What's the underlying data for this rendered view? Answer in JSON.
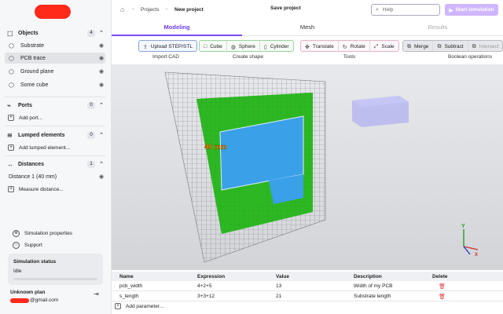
{
  "sidebar": {
    "objects": {
      "title": "Objects",
      "count": "4",
      "items": [
        {
          "label": "Substrate",
          "icon": "cube-icon"
        },
        {
          "label": "PCB trace",
          "icon": "cube-icon"
        },
        {
          "label": "Ground plane",
          "icon": "cube-icon"
        },
        {
          "label": "Some cube",
          "icon": "cube-icon"
        }
      ]
    },
    "ports": {
      "title": "Ports",
      "count": "0",
      "add": "Add port..."
    },
    "lumped": {
      "title": "Lumped elements",
      "count": "0",
      "add": "Add lumped element..."
    },
    "distances": {
      "title": "Distances",
      "count": "1",
      "items": [
        {
          "label": "Distance 1 (40 mm)"
        }
      ],
      "add": "Measure distance..."
    },
    "sim_props": "Simulation properties",
    "support": "Support",
    "status": {
      "title": "Simulation status",
      "value": "Idle"
    },
    "user": {
      "plan": "Unknown plan",
      "email_suffix": "@gmail.com"
    }
  },
  "topbar": {
    "breadcrumb": [
      "Projects",
      "New project"
    ],
    "save_label": "Save project",
    "help_placeholder": "Help",
    "start_label": "Start simulation"
  },
  "tabs": [
    {
      "label": "Modeling",
      "state": "active"
    },
    {
      "label": "Mesh",
      "state": "normal"
    },
    {
      "label": "Results",
      "state": "disabled"
    }
  ],
  "toolbar": {
    "import": {
      "label": "Import CAD",
      "buttons": [
        "Upload STEP/STL"
      ]
    },
    "shape": {
      "label": "Create shape",
      "buttons": [
        "Cube",
        "Sphere",
        "Cylinder"
      ]
    },
    "tools": {
      "label": "Tools",
      "buttons": [
        "Translate",
        "Rotate",
        "Scale"
      ]
    },
    "boolean": {
      "label": "Boolean operations",
      "buttons": [
        "Merge",
        "Subtract",
        "Intersect"
      ]
    }
  },
  "viewport": {
    "measure_label": "40 mm",
    "axis_y": "Y",
    "axis_x": "X",
    "colors": {
      "substrate": "#2db823",
      "trace": "#3aa0e8",
      "cube": "#b4b4f0"
    }
  },
  "params": {
    "headers": [
      "Name",
      "Expression",
      "Value",
      "Description",
      "Delete"
    ],
    "rows": [
      {
        "name": "pcb_width",
        "expr": "4+2+5",
        "value": "13",
        "desc": "Width of my PCB"
      },
      {
        "name": "s_length",
        "expr": "3+3+12",
        "value": "21",
        "desc": "Substrate length"
      }
    ],
    "add": "Add parameter..."
  }
}
